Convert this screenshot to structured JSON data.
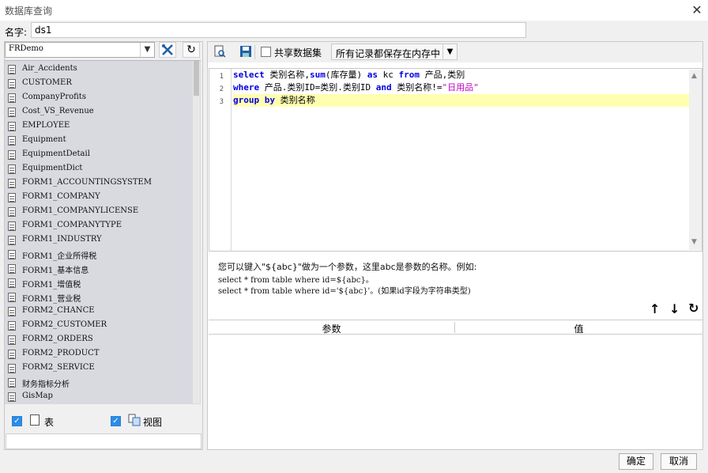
{
  "window": {
    "title": "数据库查询",
    "close": "✕"
  },
  "name_field": {
    "label": "名字:",
    "value": "ds1"
  },
  "left": {
    "db_select": "FRDemo",
    "tables": [
      "Air_Accidents",
      "CUSTOMER",
      "CompanyProfits",
      "Cost_VS_Revenue",
      "EMPLOYEE",
      "Equipment",
      "EquipmentDetail",
      "EquipmentDict",
      "FORM1_ACCOUNTINGSYSTEM",
      "FORM1_COMPANY",
      "FORM1_COMPANYLICENSE",
      "FORM1_COMPANYTYPE",
      "FORM1_INDUSTRY",
      "FORM1_企业所得税",
      "FORM1_基本信息",
      "FORM1_增值税",
      "FORM1_营业税",
      "FORM2_CHANCE",
      "FORM2_CUSTOMER",
      "FORM2_ORDERS",
      "FORM2_PRODUCT",
      "FORM2_SERVICE",
      "财务指标分析",
      "GisMap"
    ],
    "check_table_label": "表",
    "check_view_label": "视图"
  },
  "toolbar": {
    "share_label": "共享数据集",
    "memory_option": "所有记录都保存在内存中"
  },
  "editor": {
    "line_numbers": [
      "1",
      "2",
      "3"
    ],
    "lines": [
      [
        {
          "t": "select",
          "c": "kw"
        },
        {
          "t": " 类别名称,",
          "c": ""
        },
        {
          "t": "sum",
          "c": "kw"
        },
        {
          "t": "(库存量) ",
          "c": ""
        },
        {
          "t": "as",
          "c": "kw"
        },
        {
          "t": " kc ",
          "c": ""
        },
        {
          "t": "from",
          "c": "kw"
        },
        {
          "t": " 产品,类别",
          "c": ""
        }
      ],
      [
        {
          "t": "where",
          "c": "kw"
        },
        {
          "t": " 产品.类别ID=类别.类别ID ",
          "c": ""
        },
        {
          "t": "and",
          "c": "kw"
        },
        {
          "t": " 类别名称!=",
          "c": ""
        },
        {
          "t": "\"日用品\"",
          "c": "str"
        }
      ],
      [
        {
          "t": "group by",
          "c": "kw"
        },
        {
          "t": " 类别名称",
          "c": ""
        }
      ]
    ]
  },
  "hint": {
    "line1": "您可以键入\"${abc}\"做为一个参数，这里abc是参数的名称。例如:",
    "line2": "select * from table where id=${abc}。",
    "line3": "select * from table where id='${abc}'。(如果id字段为字符串类型)"
  },
  "params": {
    "col_param": "参数",
    "col_value": "值"
  },
  "footer": {
    "ok": "确定",
    "cancel": "取消"
  }
}
